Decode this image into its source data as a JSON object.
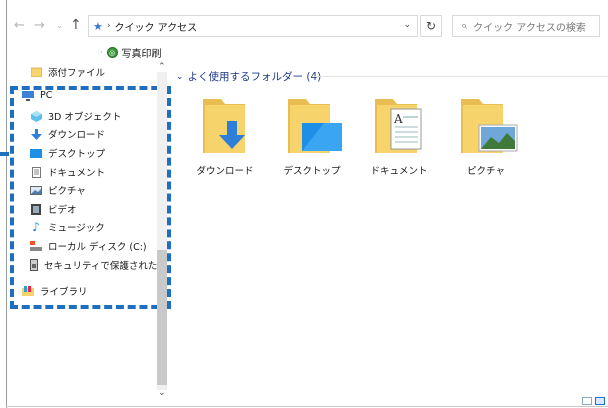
{
  "address": {
    "breadcrumb_sep": "›",
    "path": "クイック アクセス"
  },
  "search": {
    "placeholder": "クイック アクセスの検索"
  },
  "ribbon": {
    "photo_print": "写真印刷"
  },
  "nav_pane": {
    "top_item": "添付ファイル",
    "items": [
      {
        "label": "PC",
        "icon": "pc-icon"
      },
      {
        "label": "3D オブジェクト",
        "icon": "3d-objects-icon"
      },
      {
        "label": "ダウンロード",
        "icon": "download-icon"
      },
      {
        "label": "デスクトップ",
        "icon": "desktop-icon"
      },
      {
        "label": "ドキュメント",
        "icon": "document-icon"
      },
      {
        "label": "ピクチャ",
        "icon": "pictures-icon"
      },
      {
        "label": "ビデオ",
        "icon": "video-icon"
      },
      {
        "label": "ミュージック",
        "icon": "music-icon"
      },
      {
        "label": "ローカル ディスク (C:)",
        "icon": "local-disk-icon"
      },
      {
        "label": "セキュリティで保護された記憶域",
        "icon": "secure-storage-icon"
      },
      {
        "label": "ライブラリ",
        "icon": "library-icon"
      }
    ]
  },
  "main": {
    "section_title": "よく使用するフォルダー (4)",
    "folders": [
      {
        "label": "ダウンロード",
        "icon": "download-folder-icon"
      },
      {
        "label": "デスクトップ",
        "icon": "desktop-folder-icon"
      },
      {
        "label": "ドキュメント",
        "icon": "documents-folder-icon"
      },
      {
        "label": "ピクチャ",
        "icon": "pictures-folder-icon"
      }
    ]
  },
  "colors": {
    "highlight_dash": "#1f6fc0",
    "folder_yellow": "#f6d36b",
    "section_text": "#1e3a8a"
  }
}
